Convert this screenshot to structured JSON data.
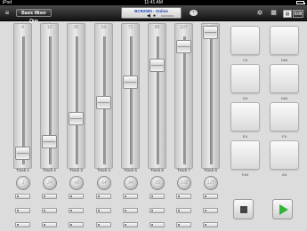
{
  "status": {
    "carrier": "iPod",
    "time": "11:41 AM"
  },
  "toolbar": {
    "mixer_label": "Basic Mixer One",
    "lcd_line1": "BCR2000 - Online",
    "chevron_icon": "chevron-left-icon",
    "gear_icon": "gear-icon",
    "edit_label": "Edit"
  },
  "tracks": [
    {
      "label": "Track 1",
      "value": "4",
      "level": 0.05
    },
    {
      "label": "Track 2",
      "value": "13",
      "level": 0.14
    },
    {
      "label": "Track 3",
      "value": "35",
      "level": 0.32
    },
    {
      "label": "Track 4",
      "value": "53",
      "level": 0.45
    },
    {
      "label": "Track 5",
      "value": "71",
      "level": 0.61
    },
    {
      "label": "Track 6",
      "value": "89",
      "level": 0.74
    },
    {
      "label": "Track 7",
      "value": "107",
      "level": 0.89
    },
    {
      "label": "Track 8",
      "value": "127",
      "level": 1.0
    }
  ],
  "knobs": [
    "1",
    "24",
    "43",
    "64",
    "84",
    "83",
    "102",
    "127"
  ],
  "pads": [
    {
      "label": "C4"
    },
    {
      "label": "D#4"
    },
    {
      "label": "D4"
    },
    {
      "label": "D#4"
    },
    {
      "label": "E4"
    },
    {
      "label": "F4"
    },
    {
      "label": "F#4"
    },
    {
      "label": "G4"
    }
  ],
  "transport": {
    "stop_icon": "stop-icon",
    "play_icon": "play-icon",
    "play_color": "#33b33a"
  }
}
